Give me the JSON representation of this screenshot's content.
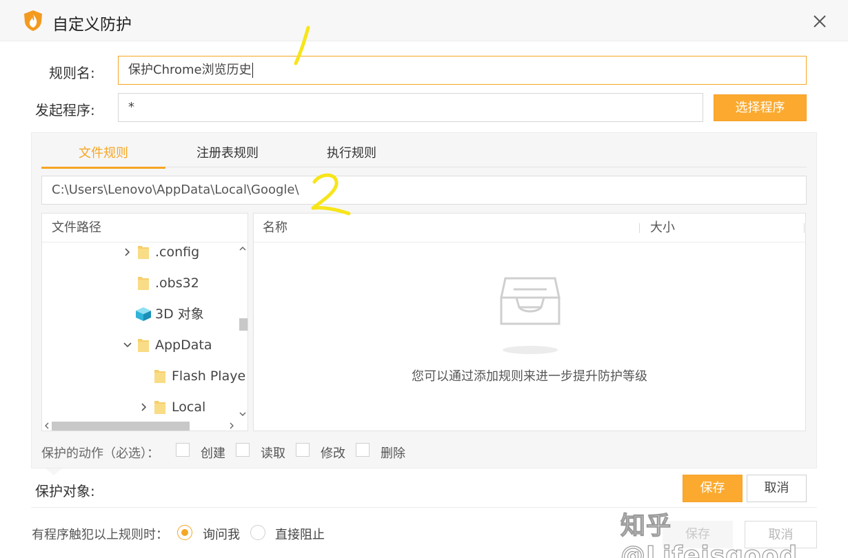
{
  "window": {
    "title": "自定义防护"
  },
  "form": {
    "rule_name_label": "规则名:",
    "rule_name_value": "保护Chrome浏览历史",
    "launcher_label": "发起程序:",
    "launcher_value": "*",
    "select_program_label": "选择程序"
  },
  "tabs": [
    {
      "label": "文件规则",
      "active": true
    },
    {
      "label": "注册表规则",
      "active": false
    },
    {
      "label": "执行规则",
      "active": false
    }
  ],
  "path_value": "C:\\Users\\Lenovo\\AppData\\Local\\Google\\",
  "tree": {
    "header": "文件路径",
    "items": [
      {
        "label": ".config",
        "expander": "collapsed",
        "icon": "folder-icon"
      },
      {
        "label": ".obs32",
        "expander": "none",
        "icon": "folder-icon"
      },
      {
        "label": "3D 对象",
        "expander": "none",
        "icon": "3d-objects-icon"
      },
      {
        "label": "AppData",
        "expander": "expanded",
        "icon": "folder-icon"
      },
      {
        "label": "Flash Playe",
        "expander": "none",
        "icon": "folder-icon"
      },
      {
        "label": "Local",
        "expander": "collapsed",
        "icon": "folder-icon"
      }
    ]
  },
  "list": {
    "columns": [
      "名称",
      "大小"
    ],
    "empty_message": "您可以通过添加规则来进一步提升防护等级"
  },
  "actions": {
    "label": "保护的动作（必选）：",
    "options": [
      {
        "label": "创建",
        "checked": false
      },
      {
        "label": "读取",
        "checked": false
      },
      {
        "label": "修改",
        "checked": false
      },
      {
        "label": "删除",
        "checked": false
      }
    ]
  },
  "protect_target": {
    "label": "保护对象:",
    "save_label": "保存",
    "cancel_label": "取消"
  },
  "violation": {
    "label": "有程序触犯以上规则时：",
    "options": [
      {
        "label": "询问我",
        "selected": true
      },
      {
        "label": "直接阻止",
        "selected": false
      }
    ],
    "save_label": "保存",
    "cancel_label": "取消"
  },
  "watermark": "知乎 @Lifeisgood",
  "annotations": [
    "1",
    "2"
  ],
  "colors": {
    "accent": "#f5a623",
    "primary_button": "#fbaa2f",
    "panel_bg": "#f6f6f6",
    "annotation": "#f7e51a"
  }
}
